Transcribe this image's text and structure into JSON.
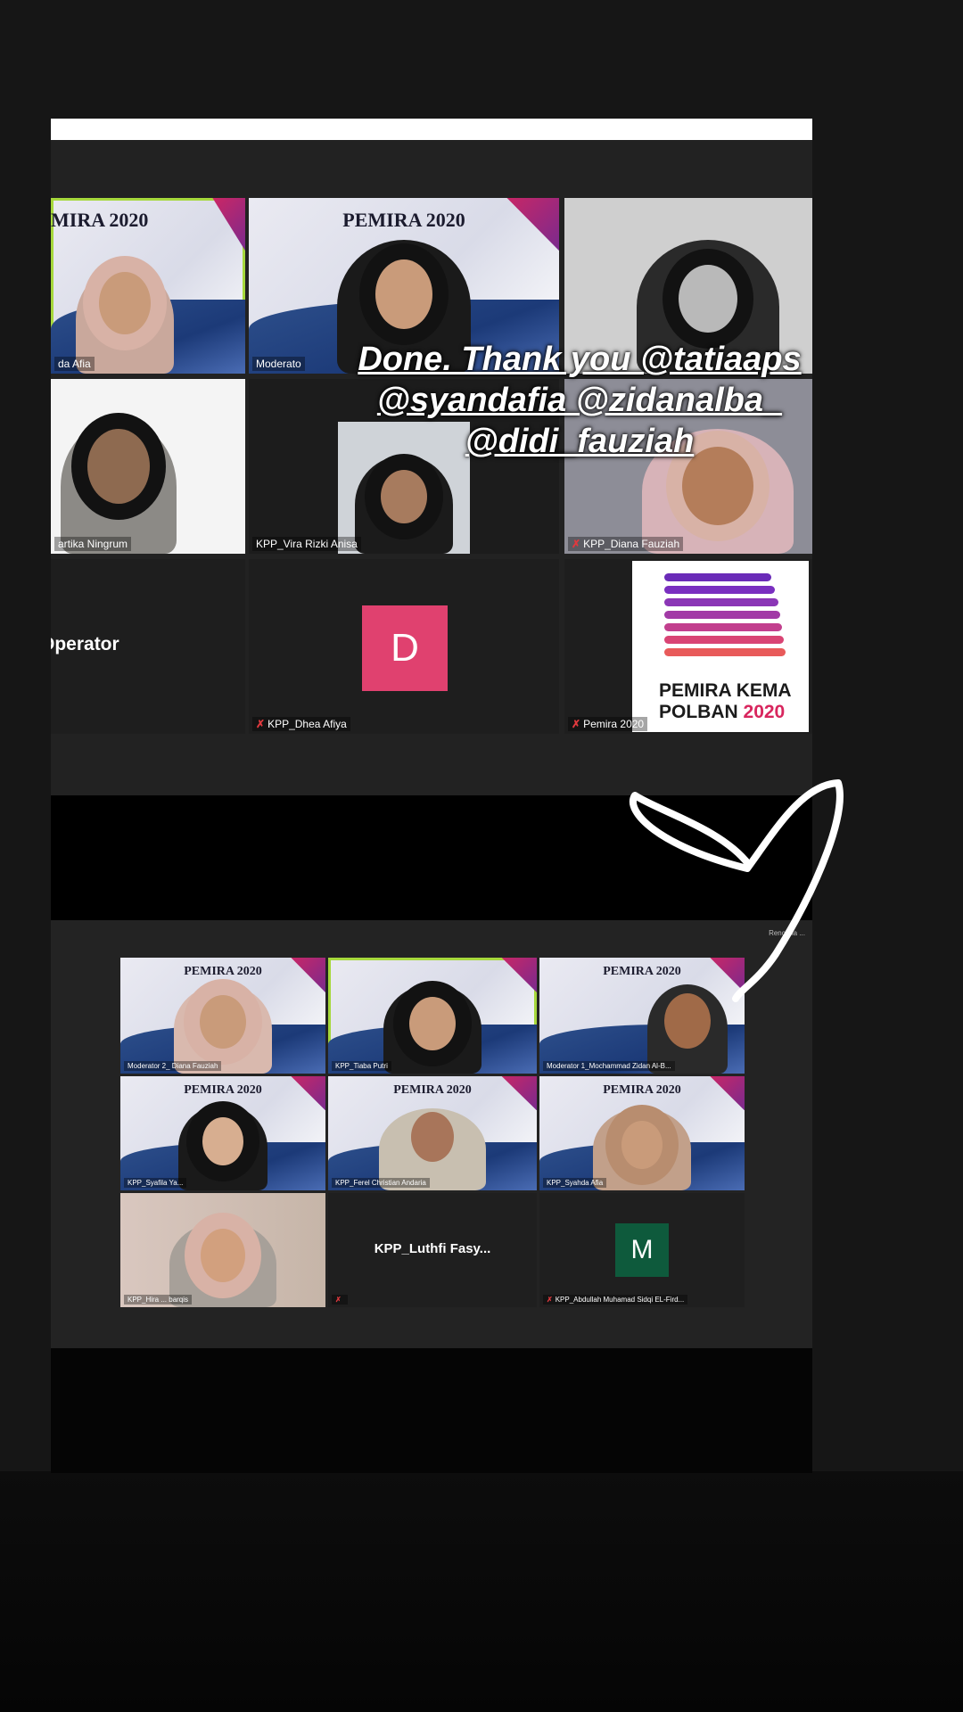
{
  "overlay": {
    "line1": "Done. Thank you @tatiaaps",
    "line2": "@syandafia @zidanalba_",
    "line3": "@didi_fauziah"
  },
  "top_grid": {
    "banner_title": "MIRA 2020",
    "banner_title_full": "PEMIRA 2020",
    "tiles": [
      {
        "label": "da Afia"
      },
      {
        "label": "Moderato"
      },
      {
        "label": ""
      },
      {
        "label": "artika Ningrum"
      },
      {
        "label": "KPP_Vira Rizki Anisa"
      },
      {
        "label": "KPP_Diana Fauziah"
      },
      {
        "center_name": "Operator"
      },
      {
        "label": "KPP_Dhea Afiya",
        "avatar": "D"
      },
      {
        "label": "Pemira 2020"
      }
    ],
    "logo": {
      "line1": "PEMIRA KEMA",
      "line2": "POLBAN",
      "year": "2020"
    }
  },
  "bottom_grid": {
    "recording_label": "Rencana ...",
    "banner_title": "PEMIRA 2020",
    "tiles": [
      {
        "label": "Moderator 2_ Diana Fauziah"
      },
      {
        "label": "KPP_Tiaba Putri"
      },
      {
        "label": "Moderator 1_Mochammad Zidan Al-B..."
      },
      {
        "label": "KPP_Syafila Ya..."
      },
      {
        "label": "KPP_Ferel Christian Andaria"
      },
      {
        "label": "KPP_Syahda Afia"
      },
      {
        "label": "KPP_Hira ... barqis"
      },
      {
        "center_name": "KPP_Luthfi  Fasy..."
      },
      {
        "label": "KPP_Abdullah Muhamad Sidqi EL-Fird...",
        "avatar": "M"
      }
    ]
  },
  "colors": {
    "avatar_d": "#e0416f",
    "avatar_m": "#0e5a3c",
    "active_border": "#a6d83c",
    "logo_year": "#d8265e"
  }
}
